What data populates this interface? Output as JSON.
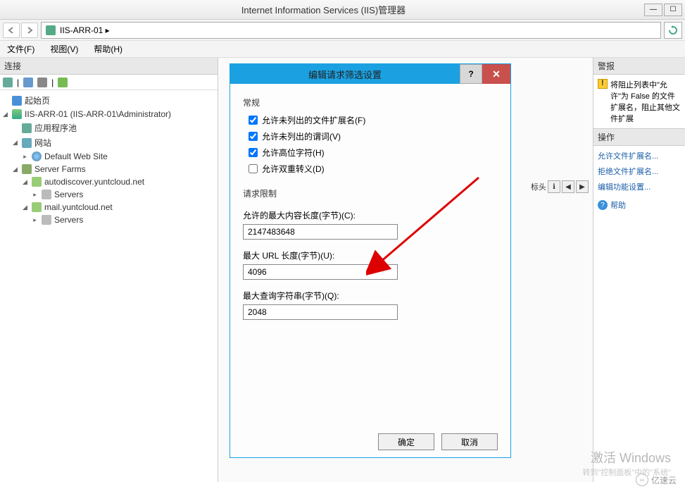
{
  "window": {
    "title": "Internet Information Services (IIS)管理器"
  },
  "addressbar": {
    "path": "IIS-ARR-01   ▸"
  },
  "menu": {
    "file": "文件(F)",
    "view": "视图(V)",
    "help": "帮助(H)"
  },
  "connections": {
    "header": "连接",
    "tree": {
      "start": "起始页",
      "server": "IIS-ARR-01 (IIS-ARR-01\\Administrator)",
      "apppools": "应用程序池",
      "sites": "网站",
      "defaultsite": "Default Web Site",
      "serverfarms": "Server Farms",
      "farm1": "autodiscover.yuntcloud.net",
      "farm1_servers": "Servers",
      "farm2": "mail.yuntcloud.net",
      "farm2_servers": "Servers"
    }
  },
  "center": {
    "header_label": "标头"
  },
  "alerts": {
    "header": "警报",
    "text": "将阻止列表中\"允许\"为 False 的文件扩展名，阻止其他文件扩展"
  },
  "actions": {
    "header": "操作",
    "allow_ext": "允许文件扩展名...",
    "deny_ext": "拒绝文件扩展名...",
    "edit_settings": "编辑功能设置...",
    "help": "帮助"
  },
  "dialog": {
    "title": "编辑请求筛选设置",
    "general_section": "常规",
    "cb_ext": "允许未列出的文件扩展名(F)",
    "cb_verb": "允许未列出的谓词(V)",
    "cb_highbit": "允许高位字符(H)",
    "cb_doubleesc": "允许双重转义(D)",
    "limits_section": "请求限制",
    "max_content_label": "允许的最大内容长度(字节)(C):",
    "max_content_value": "2147483648",
    "max_url_label": "最大 URL 长度(字节)(U):",
    "max_url_value": "4096",
    "max_query_label": "最大查询字符串(字节)(Q):",
    "max_query_value": "2048",
    "ok": "确定",
    "cancel": "取消"
  },
  "watermark": {
    "line1": "激活 Windows",
    "line2": "转到\"控制面板\"中的\"系统\"",
    "logo": "亿速云"
  }
}
